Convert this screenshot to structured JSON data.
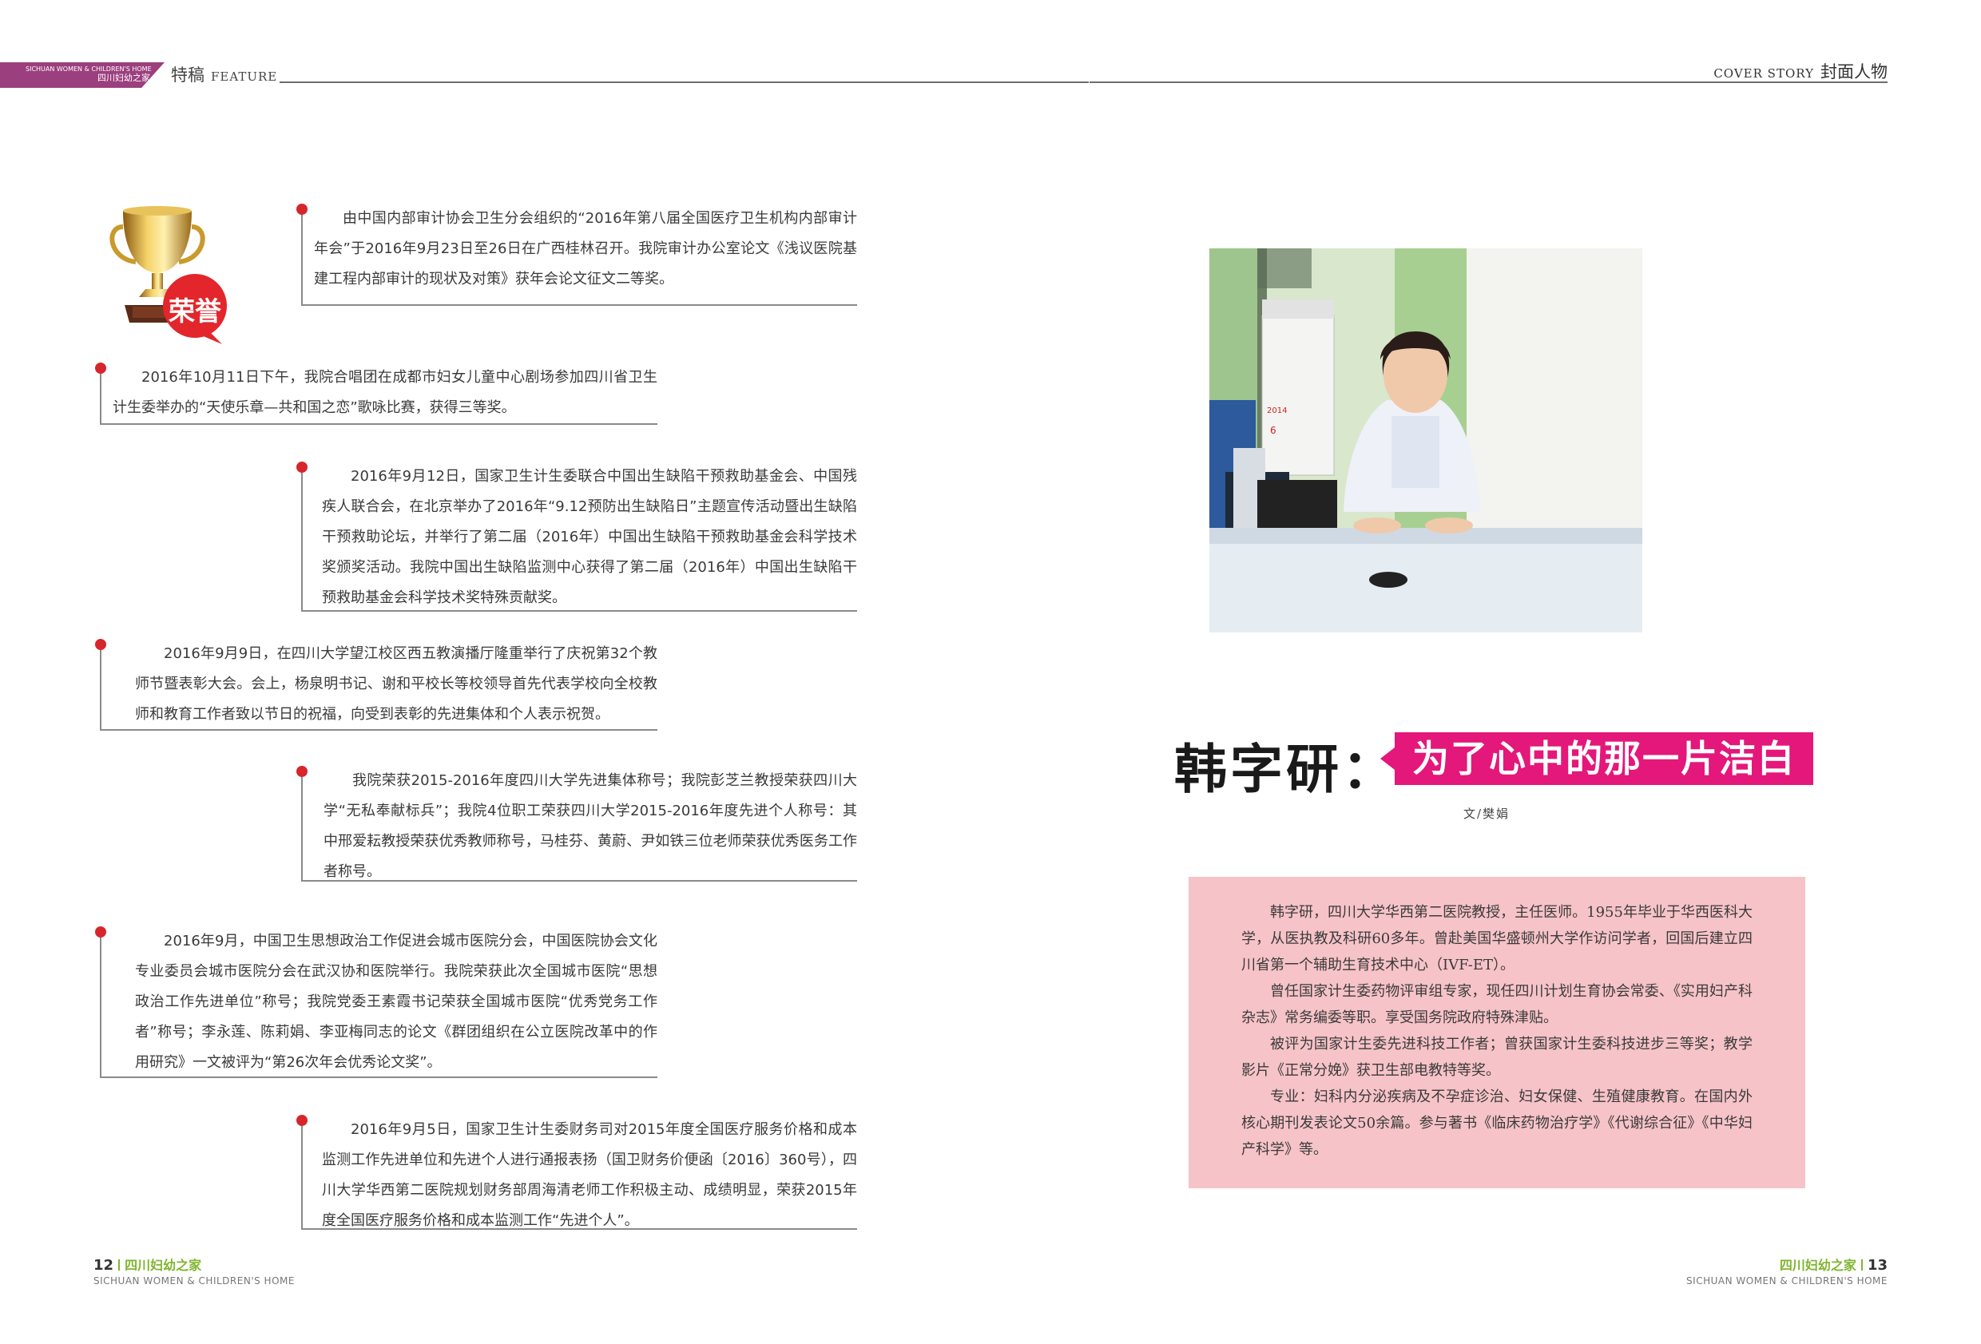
{
  "header": {
    "brand_en": "SICHUAN WOMEN & CHILDREN'S HOME",
    "brand_cn": "四川妇幼之家",
    "left_section_cn": "特稿",
    "left_section_en": "FEATURE",
    "right_section_en": "COVER STORY",
    "right_section_cn": "封面人物"
  },
  "honor_badge": "荣誉",
  "news": [
    "由中国内部审计协会卫生分会组织的“2016年第八届全国医疗卫生机构内部审计年会”于2016年9月23日至26日在广西桂林召开。我院审计办公室论文《浅议医院基建工程内部审计的现状及对策》获年会论文征文二等奖。",
    "2016年10月11日下午，我院合唱团在成都市妇女儿童中心剧场参加四川省卫生计生委举办的“天使乐章—共和国之恋”歌咏比赛，获得三等奖。",
    "2016年9月12日，国家卫生计生委联合中国出生缺陷干预救助基金会、中国残疾人联合会，在北京举办了2016年“9.12预防出生缺陷日”主题宣传活动暨出生缺陷干预救助论坛，并举行了第二届（2016年）中国出生缺陷干预救助基金会科学技术奖颁奖活动。我院中国出生缺陷监测中心获得了第二届（2016年）中国出生缺陷干预救助基金会科学技术奖特殊贡献奖。",
    "2016年9月9日，在四川大学望江校区西五教演播厅隆重举行了庆祝第32个教师节暨表彰大会。会上，杨泉明书记、谢和平校长等校领导首先代表学校向全校教师和教育工作者致以节日的祝福，向受到表彰的先进集体和个人表示祝贺。",
    "我院荣获2015-2016年度四川大学先进集体称号；我院彭芝兰教授荣获四川大学“无私奉献标兵”；我院4位职工荣获四川大学2015-2016年度先进个人称号：其中邢爱耘教授荣获优秀教师称号，马桂芬、黄蔚、尹如铁三位老师荣获优秀医务工作者称号。",
    "2016年9月，中国卫生思想政治工作促进会城市医院分会，中国医院协会文化专业委员会城市医院分会在武汉协和医院举行。我院荣获此次全国城市医院“思想政治工作先进单位”称号；我院党委王素霞书记荣获全国城市医院“优秀党务工作者”称号；李永莲、陈莉娟、李亚梅同志的论文《群团组织在公立医院改革中的作用研究》一文被评为“第26次年会优秀论文奖”。",
    "2016年9月5日，国家卫生计生委财务司对2015年度全国医疗服务价格和成本监测工作先进单位和先进个人进行通报表扬（国卫财务价便函〔2016〕360号），四川大学华西第二医院规划财务部周海清老师工作积极主动、成绩明显，荣获2015年度全国医疗服务价格和成本监测工作“先进个人”。"
  ],
  "photo": {
    "calendar_year": "2014",
    "calendar_month": "6"
  },
  "article": {
    "name": "韩字研：",
    "subtitle": "为了心中的那一片洁白",
    "byline": "文/樊娟"
  },
  "bio": [
    "韩字研，四川大学华西第二医院教授，主任医师。1955年毕业于华西医科大学，从医执教及科研60多年。曾赴美国华盛顿州大学作访问学者，回国后建立四川省第一个辅助生育技术中心（IVF-ET）。",
    "曾任国家计生委药物评审组专家，现任四川计划生育协会常委、《实用妇产科杂志》常务编委等职。享受国务院政府特殊津贴。",
    "被评为国家计生委先进科技工作者；曾获国家计生委科技进步三等奖；教学影片《正常分娩》获卫生部电教特等奖。",
    "专业：妇科内分泌疾病及不孕症诊治、妇女保健、生殖健康教育。在国内外核心期刊发表论文50余篇。参与著书《临床药物治疗学》《代谢综合征》《中华妇产科学》等。"
  ],
  "footer": {
    "left_page": "12",
    "right_page": "13",
    "magazine_cn": "四川妇幼之家",
    "magazine_en": "SICHUAN WOMEN & CHILDREN'S HOME"
  },
  "colors": {
    "accent_pink": "#e4177a",
    "bio_box": "#f6c3c8",
    "bullet_red": "#d6262c",
    "brand_purple": "#9b3f7e",
    "footer_green": "#7fb52e"
  }
}
